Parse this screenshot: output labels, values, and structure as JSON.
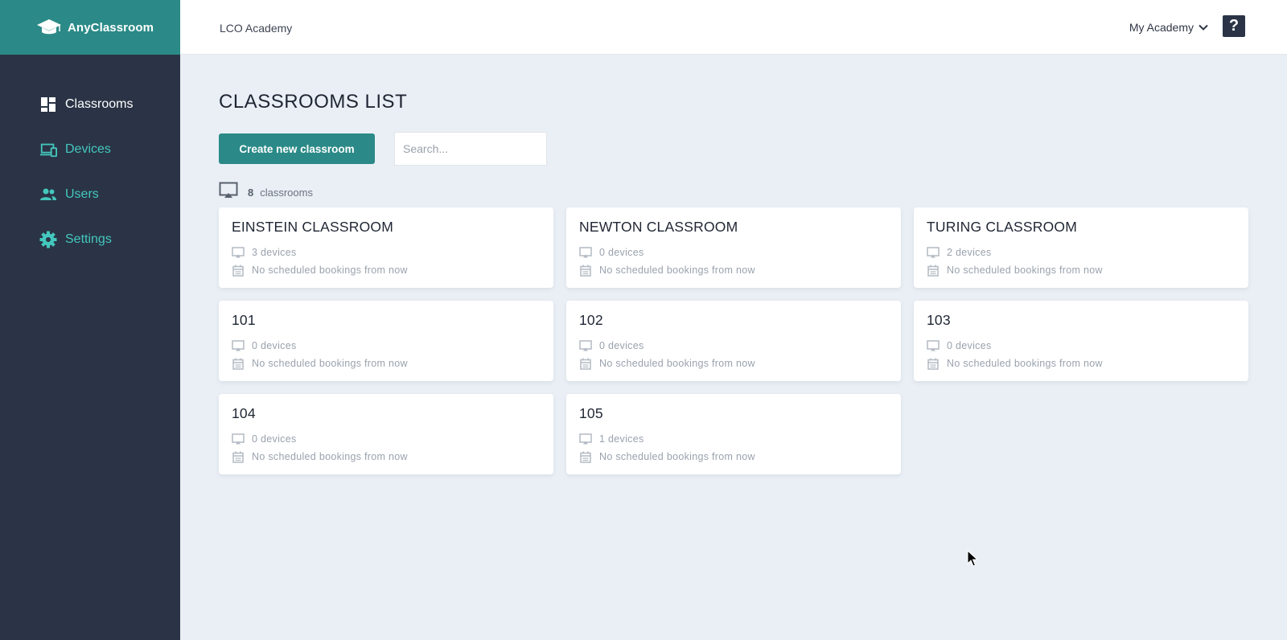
{
  "app": {
    "name": "AnyClassroom",
    "academy": "LCO Academy"
  },
  "sidebar": {
    "items": [
      {
        "label": "Classrooms",
        "icon": "dashboard-icon",
        "active": true
      },
      {
        "label": "Devices",
        "icon": "devices-icon",
        "active": false
      },
      {
        "label": "Users",
        "icon": "users-icon",
        "active": false
      },
      {
        "label": "Settings",
        "icon": "gear-icon",
        "active": false
      }
    ]
  },
  "header": {
    "account_label": "My Academy",
    "help_label": "?"
  },
  "main": {
    "title": "CLASSROOMS LIST",
    "create_label": "Create new classroom",
    "search_placeholder": "Search...",
    "count": "8",
    "count_label": "classrooms"
  },
  "classrooms": [
    {
      "name": "EINSTEIN CLASSROOM",
      "devices": "3 devices",
      "bookings": "No scheduled bookings from now"
    },
    {
      "name": "NEWTON CLASSROOM",
      "devices": "0 devices",
      "bookings": "No scheduled bookings from now"
    },
    {
      "name": "TURING CLASSROOM",
      "devices": "2 devices",
      "bookings": "No scheduled bookings from now"
    },
    {
      "name": "101",
      "devices": "0 devices",
      "bookings": "No scheduled bookings from now"
    },
    {
      "name": "102",
      "devices": "0 devices",
      "bookings": "No scheduled bookings from now"
    },
    {
      "name": "103",
      "devices": "0 devices",
      "bookings": "No scheduled bookings from now"
    },
    {
      "name": "104",
      "devices": "0 devices",
      "bookings": "No scheduled bookings from now"
    },
    {
      "name": "105",
      "devices": "1 devices",
      "bookings": "No scheduled bookings from now"
    }
  ],
  "colors": {
    "brand": "#2b8a87",
    "sidebar": "#2a3446",
    "accent_text": "#44c7bd",
    "background": "#eaeff5"
  }
}
